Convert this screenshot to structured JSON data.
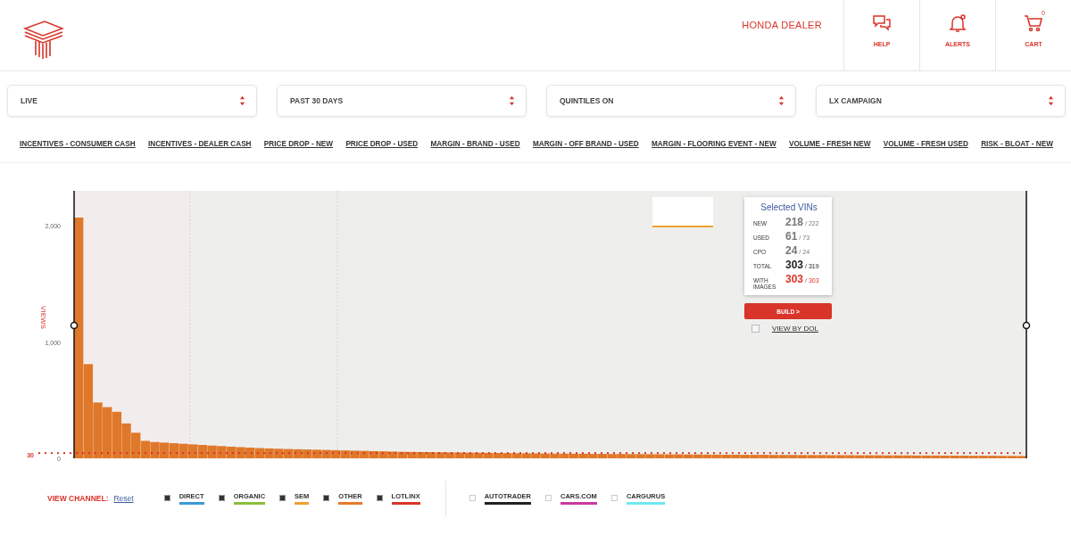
{
  "header": {
    "dealer": "HONDA DEALER",
    "actions": [
      {
        "kind": "help",
        "label": "HELP"
      },
      {
        "kind": "alerts",
        "label": "ALERTS"
      },
      {
        "kind": "cart",
        "label": "CART",
        "count": "0"
      }
    ]
  },
  "filters": [
    {
      "value": "LIVE"
    },
    {
      "value": "PAST 30 DAYS"
    },
    {
      "value": "QUINTILES ON"
    },
    {
      "value": "LX CAMPAIGN"
    }
  ],
  "campaign_links": [
    "INCENTIVES - CONSUMER CASH",
    "INCENTIVES - DEALER CASH",
    "PRICE DROP - NEW",
    "PRICE DROP - USED",
    "MARGIN - BRAND - USED",
    "MARGIN - OFF BRAND - USED",
    "MARGIN - FLOORING EVENT - NEW",
    "VOLUME - FRESH NEW",
    "VOLUME - FRESH USED",
    "RISK - BLOAT - NEW"
  ],
  "chart": {
    "chart_data": {
      "type": "bar",
      "ylabel": "VIEWS",
      "ylim": [
        0,
        2300
      ],
      "yticks": [
        {
          "value": 0,
          "label": "0"
        },
        {
          "value": 1000,
          "label": "1,000"
        },
        {
          "value": 2000,
          "label": "2,000"
        }
      ],
      "categories": [
        null,
        null,
        null,
        null,
        null,
        null,
        null,
        null,
        null,
        null,
        null,
        null,
        null,
        null,
        null,
        null,
        null,
        null,
        null,
        null,
        null,
        null,
        null,
        null,
        null,
        null,
        null,
        null,
        null,
        null,
        null,
        null,
        null,
        null,
        null,
        null,
        null,
        null,
        null,
        null,
        null,
        null,
        null,
        null,
        null,
        null,
        null,
        null,
        null,
        null,
        null,
        null,
        null,
        null,
        null,
        null,
        null,
        null,
        null,
        null,
        null,
        null,
        null,
        null,
        null,
        null,
        null,
        null,
        null,
        null,
        null,
        null,
        null,
        null,
        null,
        null,
        null,
        null,
        null,
        null,
        null,
        null,
        null,
        null,
        null,
        null,
        null,
        null,
        null,
        null,
        null,
        null,
        null,
        null,
        null,
        null,
        null,
        null,
        null,
        null
      ],
      "series": [
        {
          "color": "#e0782a",
          "values": [
            2070,
            810,
            480,
            440,
            400,
            300,
            220,
            150,
            140,
            135,
            130,
            125,
            120,
            115,
            110,
            105,
            100,
            96,
            92,
            88,
            85,
            82,
            80,
            78,
            76,
            74,
            72,
            70,
            68,
            66,
            64,
            62,
            60,
            58,
            56,
            55,
            54,
            53,
            52,
            51,
            50,
            49,
            48,
            47,
            46,
            45,
            44,
            43,
            42,
            41,
            40,
            40,
            39,
            39,
            38,
            38,
            37,
            37,
            36,
            36,
            35,
            35,
            34,
            34,
            33,
            33,
            32,
            32,
            31,
            31,
            30,
            30,
            30,
            29,
            29,
            29,
            28,
            28,
            28,
            27,
            27,
            27,
            26,
            26,
            26,
            25,
            25,
            25,
            24,
            24,
            24,
            23,
            23,
            23,
            22,
            22,
            22,
            21,
            21,
            20
          ]
        }
      ]
    },
    "threshold": {
      "label": "30"
    },
    "selected_vins": {
      "title": "Selected VINs",
      "rows": [
        {
          "kind": "normal",
          "label": "NEW",
          "count": "218",
          "total": "/ 222"
        },
        {
          "kind": "normal",
          "label": "USED",
          "count": "61",
          "total": "/ 73"
        },
        {
          "kind": "normal",
          "label": "CPO",
          "count": "24",
          "total": "/ 24"
        },
        {
          "kind": "total",
          "label": "TOTAL",
          "count": "303",
          "total": "/ 319"
        },
        {
          "kind": "highlight",
          "label": "WITH IMAGES",
          "count": "303",
          "total": "/ 303"
        }
      ],
      "button": "BUILD >",
      "view_by_dol": {
        "label": "VIEW BY DOL",
        "checked": false
      }
    }
  },
  "legend": {
    "title": "VIEW CHANNEL:",
    "reset": "Reset",
    "groups": [
      [
        {
          "label": "DIRECT",
          "checked": true,
          "color": "#3a9ad9"
        },
        {
          "label": "ORGANIC",
          "checked": true,
          "color": "#8bbf3a"
        },
        {
          "label": "SEM",
          "checked": true,
          "color": "#f0a030"
        },
        {
          "label": "OTHER",
          "checked": true,
          "color": "#e8782a"
        },
        {
          "label": "LOTLINX",
          "checked": true,
          "color": "#d8342a"
        }
      ],
      [
        {
          "label": "AUTOTRADER",
          "checked": false,
          "color": "#222222"
        },
        {
          "label": "CARS.COM",
          "checked": false,
          "color": "#c83aa0"
        },
        {
          "label": "CARGURUS",
          "checked": false,
          "color": "#6ee8f0"
        }
      ]
    ]
  }
}
